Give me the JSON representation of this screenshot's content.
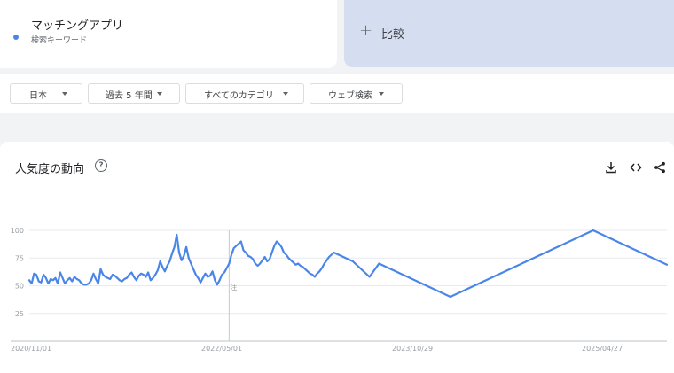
{
  "term": {
    "name": "マッチングアプリ",
    "type": "検索キーワード",
    "color": "#4a86e8"
  },
  "compare": {
    "icon": "plus-icon",
    "label": "比較"
  },
  "filters": [
    {
      "label": "日本"
    },
    {
      "label": "過去 5 年間"
    },
    {
      "label": "すべてのカテゴリ"
    },
    {
      "label": "ウェブ検索"
    }
  ],
  "panel": {
    "title": "人気度の動向",
    "help_icon": "help-circle-icon",
    "tools": [
      "download-icon",
      "embed-code-icon",
      "share-icon"
    ]
  },
  "chart_data": {
    "type": "line",
    "x_tick_labels": [
      "2020/11/01",
      "2022/05/01",
      "2023/10/29",
      "2025/04/27"
    ],
    "y_ticks": [
      25,
      50,
      75,
      100
    ],
    "ylim": [
      0,
      100
    ],
    "grid": true,
    "annotation": "注",
    "annotation_week": 84,
    "series": [
      {
        "color": "#4a86e8",
        "values": [
          55,
          52,
          61,
          60,
          54,
          53,
          60,
          57,
          52,
          56,
          55,
          57,
          52,
          62,
          57,
          52,
          55,
          57,
          54,
          58,
          56,
          55,
          52,
          51,
          51,
          52,
          55,
          61,
          56,
          52,
          65,
          60,
          58,
          57,
          56,
          60,
          59,
          57,
          55,
          54,
          56,
          57,
          60,
          62,
          58,
          55,
          59,
          61,
          60,
          58,
          62,
          55,
          57,
          60,
          64,
          72,
          67,
          63,
          68,
          72,
          79,
          85,
          96,
          80,
          73,
          77,
          85,
          75,
          70,
          65,
          60,
          57,
          53,
          57,
          61,
          58,
          59,
          63,
          55,
          51,
          55,
          60,
          62,
          66,
          70,
          78,
          84,
          86,
          88,
          90,
          82,
          80,
          77,
          76,
          74,
          70,
          68,
          70,
          73,
          76,
          72,
          74,
          80,
          86,
          90,
          88,
          85,
          80,
          78,
          75,
          73,
          71,
          69,
          70,
          68,
          67,
          65,
          63,
          61,
          60,
          58,
          61,
          63,
          66,
          70,
          73,
          76,
          78,
          80,
          79,
          78,
          77,
          76,
          75,
          74,
          73,
          72,
          70,
          68,
          66,
          64,
          62,
          60,
          58,
          61,
          64,
          67,
          70,
          69,
          68,
          67,
          66,
          65,
          64,
          63,
          62,
          61,
          60,
          59,
          58,
          57,
          56,
          55,
          54,
          53,
          52,
          51,
          50,
          49,
          48,
          47,
          46,
          45,
          44,
          43,
          42,
          41,
          40,
          41,
          42,
          43,
          44,
          45,
          46,
          47,
          48,
          49,
          50,
          51,
          52,
          53,
          54,
          55,
          56,
          57,
          58,
          59,
          60,
          61,
          62,
          63,
          64,
          65,
          66,
          67,
          68,
          69,
          70,
          71,
          72,
          73,
          74,
          75,
          76,
          77,
          78,
          79,
          80,
          81,
          82,
          83,
          84,
          85,
          86,
          87,
          88,
          89,
          90,
          91,
          92,
          93,
          94,
          95,
          96,
          97,
          98,
          99,
          100,
          99,
          98,
          97,
          96,
          95,
          94,
          93,
          92,
          91,
          90,
          89,
          88,
          87,
          86,
          85,
          84,
          83,
          82,
          81,
          80,
          79,
          78,
          77,
          76,
          75,
          74,
          73,
          72,
          71,
          70,
          69
        ]
      }
    ]
  }
}
